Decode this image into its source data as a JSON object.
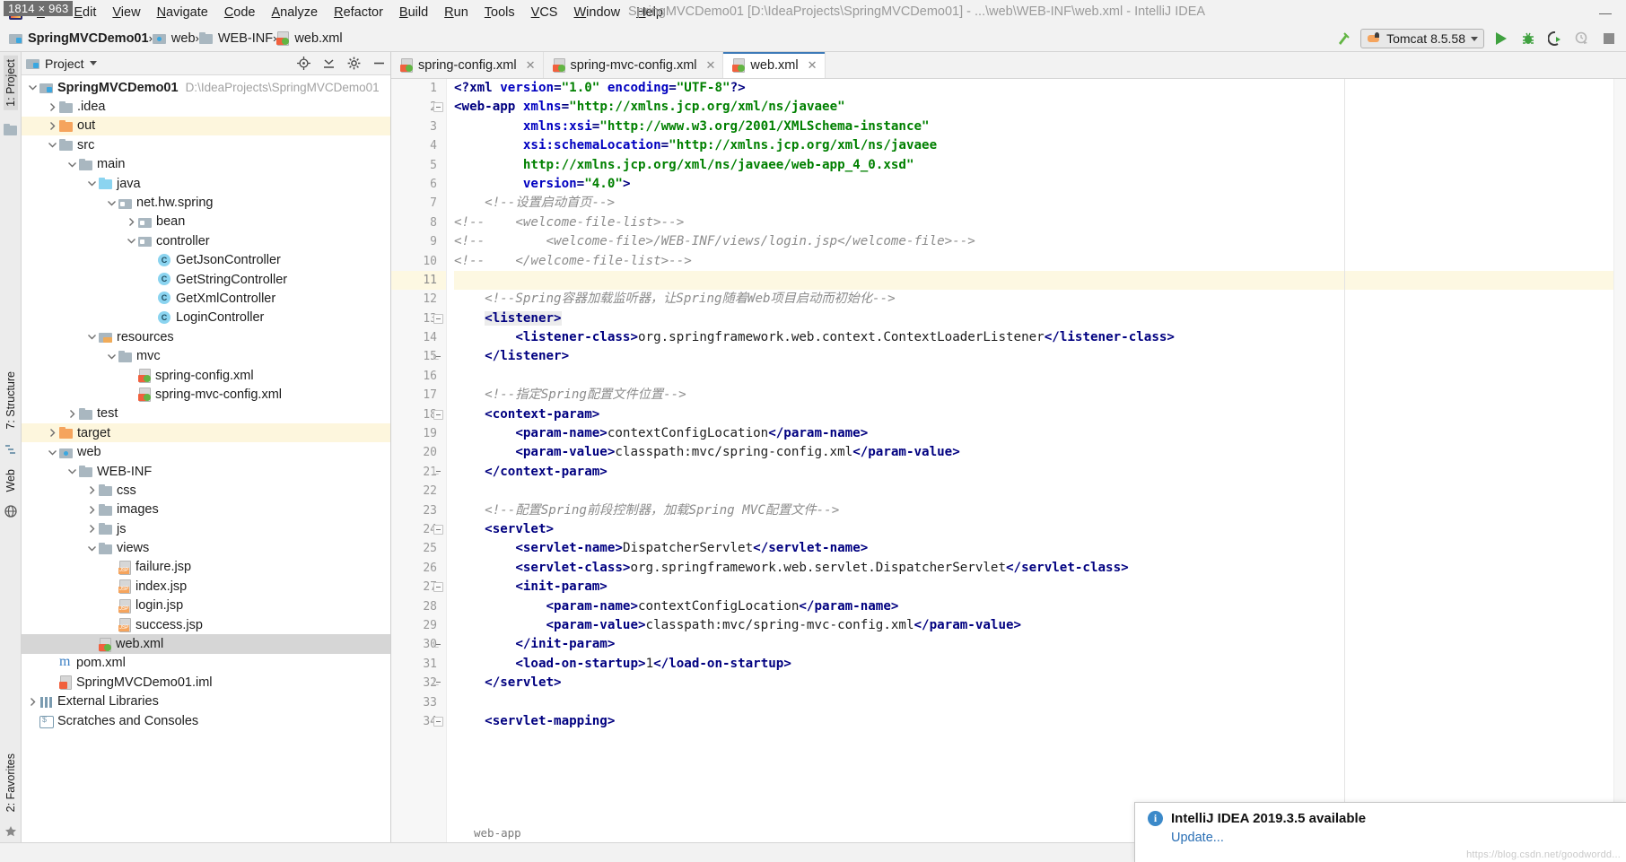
{
  "window": {
    "title": "SpringMVCDemo01 [D:\\IdeaProjects\\SpringMVCDemo01] - ...\\web\\WEB-INF\\web.xml - IntelliJ IDEA",
    "size_badge": "1814 × 963",
    "minimize_label": "—"
  },
  "menubar": {
    "items": [
      "File",
      "Edit",
      "View",
      "Navigate",
      "Code",
      "Analyze",
      "Refactor",
      "Build",
      "Run",
      "Tools",
      "VCS",
      "Window",
      "Help"
    ]
  },
  "breadcrumb": {
    "items": [
      {
        "label": "SpringMVCDemo01",
        "icon": "module-icon",
        "bold": true
      },
      {
        "label": "web",
        "icon": "web-folder-icon",
        "bold": false
      },
      {
        "label": "WEB-INF",
        "icon": "folder-icon",
        "bold": false
      },
      {
        "label": "web.xml",
        "icon": "xml-file-icon",
        "bold": false
      }
    ],
    "separator": "›"
  },
  "toolbar": {
    "run_config": "Tomcat 8.5.58",
    "buttons": [
      "build-hammer",
      "run",
      "debug",
      "run-with-coverage",
      "profile",
      "stop"
    ]
  },
  "project_panel": {
    "title": "Project",
    "header_icons": [
      "locate-icon",
      "collapse-all-icon",
      "settings-gear-icon",
      "hide-icon"
    ],
    "tree": [
      {
        "depth": 0,
        "label": "SpringMVCDemo01",
        "path": "D:\\IdeaProjects\\SpringMVCDemo01",
        "icon": "module-icon",
        "twisty": "open",
        "bold": true,
        "state": "normal"
      },
      {
        "depth": 1,
        "label": ".idea",
        "icon": "folder-icon",
        "twisty": "closed",
        "state": "normal"
      },
      {
        "depth": 1,
        "label": "out",
        "icon": "folder-orange-icon",
        "twisty": "closed",
        "state": "highlight"
      },
      {
        "depth": 1,
        "label": "src",
        "icon": "folder-icon",
        "twisty": "open",
        "state": "normal"
      },
      {
        "depth": 2,
        "label": "main",
        "icon": "folder-icon",
        "twisty": "open",
        "state": "normal"
      },
      {
        "depth": 3,
        "label": "java",
        "icon": "source-folder-icon",
        "twisty": "open",
        "state": "normal"
      },
      {
        "depth": 4,
        "label": "net.hw.spring",
        "icon": "package-icon",
        "twisty": "open",
        "state": "normal"
      },
      {
        "depth": 5,
        "label": "bean",
        "icon": "package-icon",
        "twisty": "closed",
        "state": "normal"
      },
      {
        "depth": 5,
        "label": "controller",
        "icon": "package-icon",
        "twisty": "open",
        "state": "normal"
      },
      {
        "depth": 6,
        "label": "GetJsonController",
        "icon": "java-class-icon",
        "twisty": "none",
        "state": "normal"
      },
      {
        "depth": 6,
        "label": "GetStringController",
        "icon": "java-class-icon",
        "twisty": "none",
        "state": "normal"
      },
      {
        "depth": 6,
        "label": "GetXmlController",
        "icon": "java-class-icon",
        "twisty": "none",
        "state": "normal"
      },
      {
        "depth": 6,
        "label": "LoginController",
        "icon": "java-class-icon",
        "twisty": "none",
        "state": "normal"
      },
      {
        "depth": 3,
        "label": "resources",
        "icon": "resources-folder-icon",
        "twisty": "open",
        "state": "normal"
      },
      {
        "depth": 4,
        "label": "mvc",
        "icon": "folder-icon",
        "twisty": "open",
        "state": "normal"
      },
      {
        "depth": 5,
        "label": "spring-config.xml",
        "icon": "xml-file-icon",
        "twisty": "none",
        "state": "normal"
      },
      {
        "depth": 5,
        "label": "spring-mvc-config.xml",
        "icon": "xml-file-icon",
        "twisty": "none",
        "state": "normal"
      },
      {
        "depth": 2,
        "label": "test",
        "icon": "folder-icon",
        "twisty": "closed",
        "state": "normal"
      },
      {
        "depth": 1,
        "label": "target",
        "icon": "folder-orange-icon",
        "twisty": "closed",
        "state": "highlight"
      },
      {
        "depth": 1,
        "label": "web",
        "icon": "web-folder-icon",
        "twisty": "open",
        "state": "normal"
      },
      {
        "depth": 2,
        "label": "WEB-INF",
        "icon": "folder-icon",
        "twisty": "open",
        "state": "normal"
      },
      {
        "depth": 3,
        "label": "css",
        "icon": "folder-icon",
        "twisty": "closed",
        "state": "normal"
      },
      {
        "depth": 3,
        "label": "images",
        "icon": "folder-icon",
        "twisty": "closed",
        "state": "normal"
      },
      {
        "depth": 3,
        "label": "js",
        "icon": "folder-icon",
        "twisty": "closed",
        "state": "normal"
      },
      {
        "depth": 3,
        "label": "views",
        "icon": "folder-icon",
        "twisty": "open",
        "state": "normal"
      },
      {
        "depth": 4,
        "label": "failure.jsp",
        "icon": "jsp-file-icon",
        "twisty": "none",
        "state": "normal"
      },
      {
        "depth": 4,
        "label": "index.jsp",
        "icon": "jsp-file-icon",
        "twisty": "none",
        "state": "normal"
      },
      {
        "depth": 4,
        "label": "login.jsp",
        "icon": "jsp-file-icon",
        "twisty": "none",
        "state": "normal"
      },
      {
        "depth": 4,
        "label": "success.jsp",
        "icon": "jsp-file-icon",
        "twisty": "none",
        "state": "normal"
      },
      {
        "depth": 3,
        "label": "web.xml",
        "icon": "xml-file-icon",
        "twisty": "none",
        "state": "selected"
      },
      {
        "depth": 1,
        "label": "pom.xml",
        "icon": "maven-file-icon",
        "twisty": "none",
        "state": "normal"
      },
      {
        "depth": 1,
        "label": "SpringMVCDemo01.iml",
        "icon": "iml-file-icon",
        "twisty": "none",
        "state": "normal"
      },
      {
        "depth": 0,
        "label": "External Libraries",
        "icon": "libraries-icon",
        "twisty": "closed",
        "state": "normal"
      },
      {
        "depth": 0,
        "label": "Scratches and Consoles",
        "icon": "scratches-icon",
        "twisty": "none",
        "state": "normal"
      }
    ]
  },
  "left_rail": {
    "top": "1: Project",
    "middle": [
      "7: Structure",
      "Web"
    ],
    "bottom": "2: Favorites"
  },
  "editor_tabs": [
    {
      "label": "spring-config.xml",
      "icon": "xml-file-icon",
      "active": false
    },
    {
      "label": "spring-mvc-config.xml",
      "icon": "xml-file-icon",
      "active": false
    },
    {
      "label": "web.xml",
      "icon": "xml-file-icon",
      "active": true
    }
  ],
  "editor": {
    "current_line": 11,
    "first_line": 1,
    "lines": [
      {
        "n": 1,
        "fold": "none",
        "tokens": [
          {
            "t": "proc",
            "v": "<?"
          },
          {
            "t": "tagname",
            "v": "xml "
          },
          {
            "t": "attr",
            "v": "version"
          },
          {
            "t": "proc",
            "v": "="
          },
          {
            "t": "val",
            "v": "\"1.0\""
          },
          {
            "t": "txt",
            "v": " "
          },
          {
            "t": "attr",
            "v": "encoding"
          },
          {
            "t": "proc",
            "v": "="
          },
          {
            "t": "val",
            "v": "\"UTF-8\""
          },
          {
            "t": "proc",
            "v": "?>"
          }
        ]
      },
      {
        "n": 2,
        "fold": "open",
        "tokens": [
          {
            "t": "brk",
            "v": "<"
          },
          {
            "t": "tagname",
            "v": "web-app"
          },
          {
            "t": "txt",
            "v": " "
          },
          {
            "t": "attr",
            "v": "xmlns"
          },
          {
            "t": "brk",
            "v": "="
          },
          {
            "t": "val",
            "v": "\"http://xmlns.jcp.org/xml/ns/javaee\""
          }
        ]
      },
      {
        "n": 3,
        "fold": "none",
        "tokens": [
          {
            "t": "txt",
            "v": "         "
          },
          {
            "t": "attr",
            "v": "xmlns:xsi"
          },
          {
            "t": "brk",
            "v": "="
          },
          {
            "t": "val",
            "v": "\"http://www.w3.org/2001/XMLSchema-instance\""
          }
        ]
      },
      {
        "n": 4,
        "fold": "none",
        "tokens": [
          {
            "t": "txt",
            "v": "         "
          },
          {
            "t": "attr",
            "v": "xsi:schemaLocation"
          },
          {
            "t": "brk",
            "v": "="
          },
          {
            "t": "val",
            "v": "\"http://xmlns.jcp.org/xml/ns/javaee"
          }
        ]
      },
      {
        "n": 5,
        "fold": "none",
        "tokens": [
          {
            "t": "txt",
            "v": "         "
          },
          {
            "t": "val",
            "v": "http://xmlns.jcp.org/xml/ns/javaee/web-app_4_0.xsd\""
          }
        ]
      },
      {
        "n": 6,
        "fold": "none",
        "tokens": [
          {
            "t": "txt",
            "v": "         "
          },
          {
            "t": "attr",
            "v": "version"
          },
          {
            "t": "brk",
            "v": "="
          },
          {
            "t": "val",
            "v": "\"4.0\""
          },
          {
            "t": "brk",
            "v": ">"
          }
        ]
      },
      {
        "n": 7,
        "fold": "none",
        "tokens": [
          {
            "t": "txt",
            "v": "    "
          },
          {
            "t": "cmt",
            "v": "<!--设置启动首页-->"
          }
        ]
      },
      {
        "n": 8,
        "fold": "none",
        "tokens": [
          {
            "t": "cmt",
            "v": "<!--    <welcome-file-list>-->"
          }
        ]
      },
      {
        "n": 9,
        "fold": "none",
        "tokens": [
          {
            "t": "cmt",
            "v": "<!--        <welcome-file>/WEB-INF/views/login.jsp</welcome-file>-->"
          }
        ]
      },
      {
        "n": 10,
        "fold": "none",
        "tokens": [
          {
            "t": "cmt",
            "v": "<!--    </welcome-file-list>-->"
          }
        ]
      },
      {
        "n": 11,
        "fold": "none",
        "tokens": []
      },
      {
        "n": 12,
        "fold": "none",
        "tokens": [
          {
            "t": "txt",
            "v": "    "
          },
          {
            "t": "cmt",
            "v": "<!--Spring容器加载监听器，让Spring随着Web项目启动而初始化-->"
          }
        ]
      },
      {
        "n": 13,
        "fold": "open",
        "tokens": [
          {
            "t": "txt",
            "v": "    "
          },
          {
            "t": "tokhl",
            "v": "<listener>",
            "cls": "tagname"
          }
        ]
      },
      {
        "n": 14,
        "fold": "none",
        "tokens": [
          {
            "t": "txt",
            "v": "        "
          },
          {
            "t": "tagname",
            "v": "<listener-class>"
          },
          {
            "t": "txt",
            "v": "org.springframework.web.context.ContextLoaderListener"
          },
          {
            "t": "tagname",
            "v": "</listener-class>"
          }
        ]
      },
      {
        "n": 15,
        "fold": "close",
        "tokens": [
          {
            "t": "txt",
            "v": "    "
          },
          {
            "t": "tagname",
            "v": "</listener>"
          }
        ]
      },
      {
        "n": 16,
        "fold": "none",
        "tokens": []
      },
      {
        "n": 17,
        "fold": "none",
        "tokens": [
          {
            "t": "txt",
            "v": "    "
          },
          {
            "t": "cmt",
            "v": "<!--指定Spring配置文件位置-->"
          }
        ]
      },
      {
        "n": 18,
        "fold": "open",
        "tokens": [
          {
            "t": "txt",
            "v": "    "
          },
          {
            "t": "tagname",
            "v": "<context-param>"
          }
        ]
      },
      {
        "n": 19,
        "fold": "none",
        "tokens": [
          {
            "t": "txt",
            "v": "        "
          },
          {
            "t": "tagname",
            "v": "<param-name>"
          },
          {
            "t": "txt",
            "v": "contextConfigLocation"
          },
          {
            "t": "tagname",
            "v": "</param-name>"
          }
        ]
      },
      {
        "n": 20,
        "fold": "none",
        "tokens": [
          {
            "t": "txt",
            "v": "        "
          },
          {
            "t": "tagname",
            "v": "<param-value>"
          },
          {
            "t": "txt",
            "v": "classpath:mvc/spring-config.xml"
          },
          {
            "t": "tagname",
            "v": "</param-value>"
          }
        ]
      },
      {
        "n": 21,
        "fold": "close",
        "tokens": [
          {
            "t": "txt",
            "v": "    "
          },
          {
            "t": "tagname",
            "v": "</context-param>"
          }
        ]
      },
      {
        "n": 22,
        "fold": "none",
        "tokens": []
      },
      {
        "n": 23,
        "fold": "none",
        "tokens": [
          {
            "t": "txt",
            "v": "    "
          },
          {
            "t": "cmt",
            "v": "<!--配置Spring前段控制器，加载Spring MVC配置文件-->"
          }
        ]
      },
      {
        "n": 24,
        "fold": "open",
        "tokens": [
          {
            "t": "txt",
            "v": "    "
          },
          {
            "t": "tagname",
            "v": "<servlet>"
          }
        ]
      },
      {
        "n": 25,
        "fold": "none",
        "tokens": [
          {
            "t": "txt",
            "v": "        "
          },
          {
            "t": "tagname",
            "v": "<servlet-name>"
          },
          {
            "t": "txt",
            "v": "DispatcherServlet"
          },
          {
            "t": "tagname",
            "v": "</servlet-name>"
          }
        ]
      },
      {
        "n": 26,
        "fold": "none",
        "tokens": [
          {
            "t": "txt",
            "v": "        "
          },
          {
            "t": "tagname",
            "v": "<servlet-class>"
          },
          {
            "t": "txt",
            "v": "org.springframework.web.servlet.DispatcherServlet"
          },
          {
            "t": "tagname",
            "v": "</servlet-class>"
          }
        ]
      },
      {
        "n": 27,
        "fold": "open",
        "tokens": [
          {
            "t": "txt",
            "v": "        "
          },
          {
            "t": "tagname",
            "v": "<init-param>"
          }
        ]
      },
      {
        "n": 28,
        "fold": "none",
        "tokens": [
          {
            "t": "txt",
            "v": "            "
          },
          {
            "t": "tagname",
            "v": "<param-name>"
          },
          {
            "t": "txt",
            "v": "contextConfigLocation"
          },
          {
            "t": "tagname",
            "v": "</param-name>"
          }
        ]
      },
      {
        "n": 29,
        "fold": "none",
        "tokens": [
          {
            "t": "txt",
            "v": "            "
          },
          {
            "t": "tagname",
            "v": "<param-value>"
          },
          {
            "t": "txt",
            "v": "classpath:mvc/spring-mvc-config.xml"
          },
          {
            "t": "tagname",
            "v": "</param-value>"
          }
        ]
      },
      {
        "n": 30,
        "fold": "close",
        "tokens": [
          {
            "t": "txt",
            "v": "        "
          },
          {
            "t": "tagname",
            "v": "</init-param>"
          }
        ]
      },
      {
        "n": 31,
        "fold": "none",
        "tokens": [
          {
            "t": "txt",
            "v": "        "
          },
          {
            "t": "tagname",
            "v": "<load-on-startup>"
          },
          {
            "t": "txt",
            "v": "1"
          },
          {
            "t": "tagname",
            "v": "</load-on-startup>"
          }
        ]
      },
      {
        "n": 32,
        "fold": "close",
        "tokens": [
          {
            "t": "txt",
            "v": "    "
          },
          {
            "t": "tagname",
            "v": "</servlet>"
          }
        ]
      },
      {
        "n": 33,
        "fold": "none",
        "tokens": []
      },
      {
        "n": 34,
        "fold": "open",
        "tokens": [
          {
            "t": "txt",
            "v": "    "
          },
          {
            "t": "tagname",
            "v": "<servlet-mapping>"
          }
        ]
      }
    ],
    "breadcrumb_footer": "web-app"
  },
  "notification": {
    "title": "IntelliJ IDEA 2019.3.5 available",
    "link": "Update...",
    "icon": "info-icon"
  },
  "watermark": "https://blog.csdn.net/goodwordd...",
  "colors": {
    "accent": "#3d7ab8",
    "tag": "#000080",
    "attr": "#0000c0",
    "value": "#008000",
    "comment": "#8c8c8c",
    "caret_line": "#fdf8e2",
    "selection": "#d6d6d6",
    "link": "#2a6fb5"
  }
}
